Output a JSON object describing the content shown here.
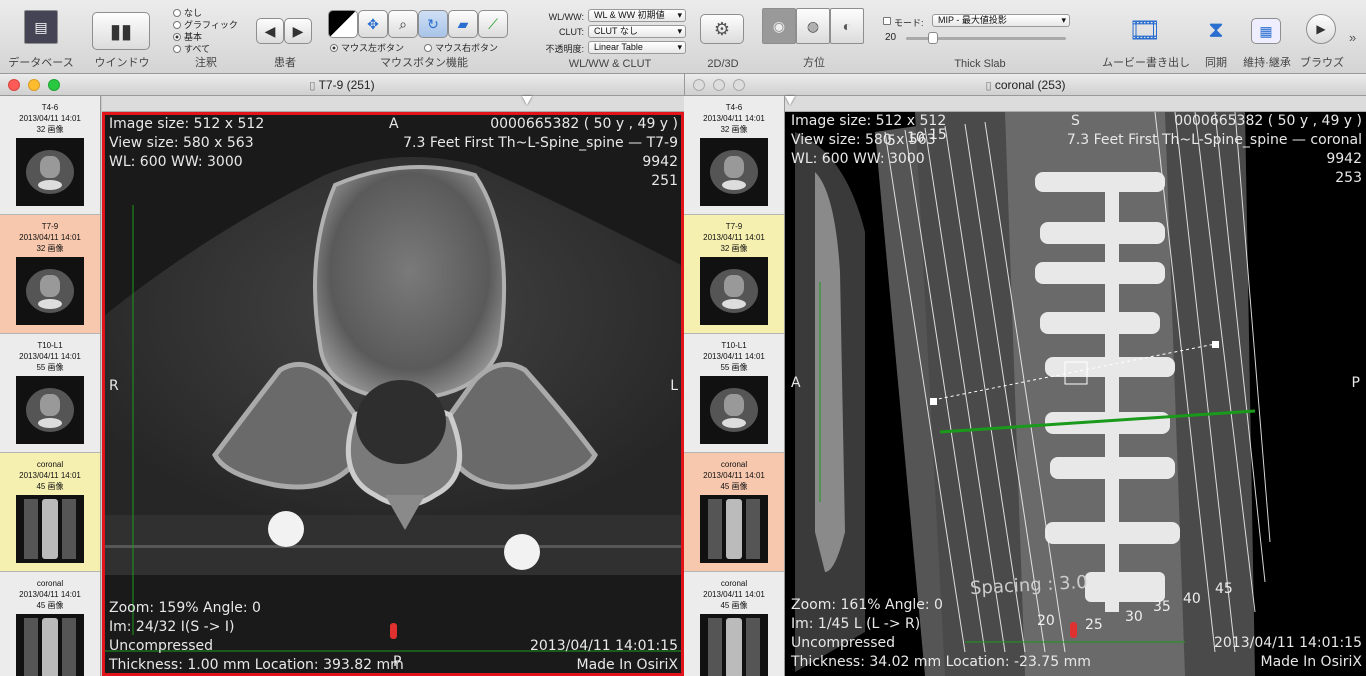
{
  "toolbar": {
    "database": "データベース",
    "window": "ウインドウ",
    "annotation": "注釈",
    "patient": "患者",
    "mouse_func": "マウスボタン機能",
    "wlww_clut": "WL/WW & CLUT",
    "d2d3": "2D/3D",
    "orient": "方位",
    "thick_slab": "Thick Slab",
    "movie": "ムービー書き出し",
    "sync": "同期",
    "keep": "維持·継承",
    "browse": "ブラウズ",
    "annot_opts": [
      "なし",
      "グラフィック",
      "基本",
      "すべて"
    ],
    "annot_selected": 2,
    "mouse_left": "マウス左ボタン",
    "mouse_right": "マウス右ボタン",
    "wlww_label": "WL/WW:",
    "wlww_value": "WL & WW 初期値",
    "clut_label": "CLUT:",
    "clut_value": "CLUT なし",
    "opacity_label": "不透明度:",
    "opacity_value": "Linear Table",
    "mode_label": "モード:",
    "mode_value": "MIP - 最大値投影",
    "slab_value": "20"
  },
  "left": {
    "title": "T7-9 (251)",
    "ov": {
      "tl1": "Image size: 512 x 512",
      "tl2": "View size: 580 x 563",
      "tl3": "WL: 600 WW: 3000",
      "tr1": "0000665382 ( 50 y , 49 y )",
      "tr2": "7.3 Feet First Th~L-Spine_spine — T7-9",
      "tr3": "9942",
      "tr4": "251",
      "top": "A",
      "left": "R",
      "right": "L",
      "bottom": "P",
      "bl1": "Zoom: 159% Angle: 0",
      "bl2": "Im: 24/32  I(S -> I)",
      "bl3": "Uncompressed",
      "bl4": "Thickness: 1.00 mm Location: 393.82 mm",
      "br1": "2013/04/11 14:01:15",
      "br2": "Made In OsiriX"
    }
  },
  "right": {
    "title": "coronal (253)",
    "ov": {
      "tl1": "Image size: 512 x 512",
      "tl2": "View size: 580 x 563",
      "tl3": "WL: 600 WW: 3000",
      "tr1": "0000665382 ( 50 y , 49 y )",
      "tr2": "7.3 Feet First Th~L-Spine_spine — coronal",
      "tr3": "9942",
      "tr4": "253",
      "top": "S",
      "left": "A",
      "right": "P",
      "bl1": "Zoom: 161% Angle: 0",
      "bl2": "Im: 1/45  L (L -> R)",
      "bl3": "Uncompressed",
      "bl4": "Thickness: 34.02 mm Location: -23.75 mm",
      "br1": "2013/04/11 14:01:15",
      "br2": "Made In OsiriX",
      "spacing": "Spacing : 3.0",
      "slab_nums": [
        "5",
        "10",
        "15",
        "20",
        "25",
        "30",
        "35",
        "40",
        "45"
      ]
    }
  },
  "series": [
    {
      "name": "T4-6",
      "date": "2013/04/11 14:01",
      "count": "32 画像"
    },
    {
      "name": "T7-9",
      "date": "2013/04/11 14:01",
      "count": "32 画像"
    },
    {
      "name": "T10-L1",
      "date": "2013/04/11 14:01",
      "count": "55 画像"
    },
    {
      "name": "coronal",
      "date": "2013/04/11 14:01",
      "count": "45 画像"
    },
    {
      "name": "coronal",
      "date": "2013/04/11 14:01",
      "count": "45 画像"
    }
  ],
  "colors": {
    "selected_left": "#f7c8ae",
    "selected_right": "#f7c8ae",
    "yellow": "#f6f0b0",
    "red_border": "#e0141a",
    "green": "#1a9a1a"
  }
}
